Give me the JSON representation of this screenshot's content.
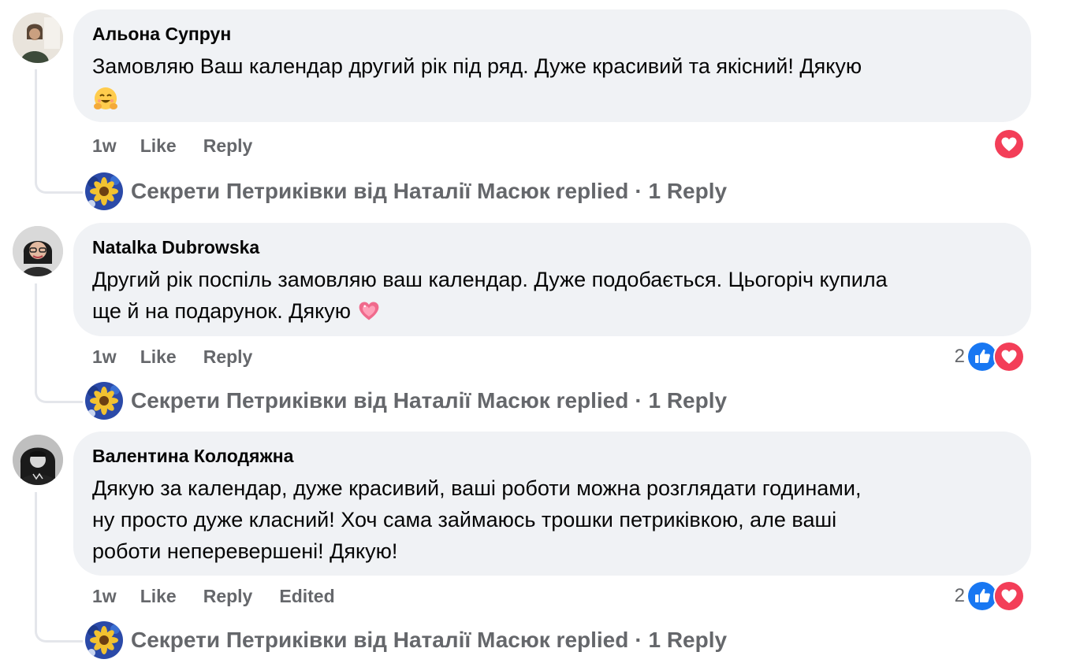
{
  "comments": [
    {
      "author": "Альона Супрун",
      "text": "Замовляю Ваш календар другий рік під ряд. Дуже красивий та якісний! Дякую",
      "emoji": "hugging-face",
      "time": "1w",
      "like": "Like",
      "reply": "Reply",
      "reactions": [
        "love"
      ],
      "reaction_count": "",
      "replied_by": "Секрети Петриківки від Наталії Масюк replied",
      "reply_count": "· 1 Reply"
    },
    {
      "author": "Natalka Dubrowska",
      "text_line1": "Другий рік поспіль замовляю ваш календар. Дуже подобається. Цьогоріч купила",
      "text_line2": "ще й на подарунок. Дякую",
      "emoji": "sparkling-heart",
      "time": "1w",
      "like": "Like",
      "reply": "Reply",
      "reactions": [
        "like",
        "love"
      ],
      "reaction_count": "2",
      "replied_by": "Секрети Петриківки від Наталії Масюк replied",
      "reply_count": "· 1 Reply"
    },
    {
      "author": "Валентина Колодяжна",
      "text_line1": "Дякую за календар, дуже красивий, ваші роботи можна розглядати годинами,",
      "text_line2": "ну просто дуже класний! Хоч сама займаюсь трошки петриківкою, але ваші",
      "text_line3": "роботи неперевершені! Дякую!",
      "time": "1w",
      "like": "Like",
      "reply": "Reply",
      "edited": "Edited",
      "reactions": [
        "like",
        "love"
      ],
      "reaction_count": "2",
      "replied_by": "Секрети Петриківки від Наталії Масюк replied",
      "reply_count": "· 1 Reply"
    }
  ],
  "colors": {
    "bubble": "#f0f2f5",
    "meta": "#65676b",
    "like_blue": "#1877f2",
    "love_red": "#f33e58"
  }
}
